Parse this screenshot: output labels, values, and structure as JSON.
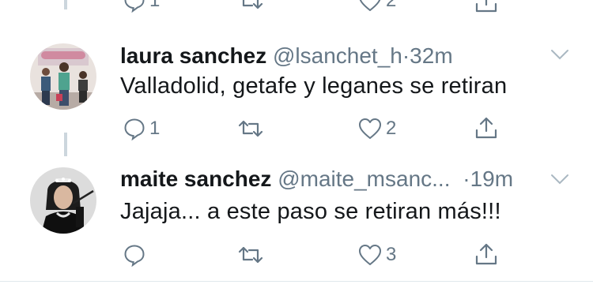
{
  "top_actions": {
    "reply_count": "1",
    "like_count": "2"
  },
  "tweets": [
    {
      "name": "laura sanchez",
      "handle": "@lsanchet_h",
      "separator": "·",
      "time": "32m",
      "text": "Valladolid, getafe y leganes se retiran",
      "reply_count": "1",
      "retweet_count": "",
      "like_count": "2"
    },
    {
      "name": "maite sanchez",
      "handle": "@maite_msanc...",
      "separator": "·",
      "time": "19m",
      "text": "Jajaja... a este paso se retiran más!!!",
      "reply_count": "",
      "retweet_count": "",
      "like_count": "3"
    }
  ],
  "colors": {
    "text": "#14171a",
    "muted": "#657786",
    "thread_line": "#ccd6dd",
    "divider": "#e1e8ed"
  },
  "icons": [
    "reply-icon",
    "retweet-icon",
    "like-icon",
    "share-icon",
    "chevron-down-icon"
  ]
}
